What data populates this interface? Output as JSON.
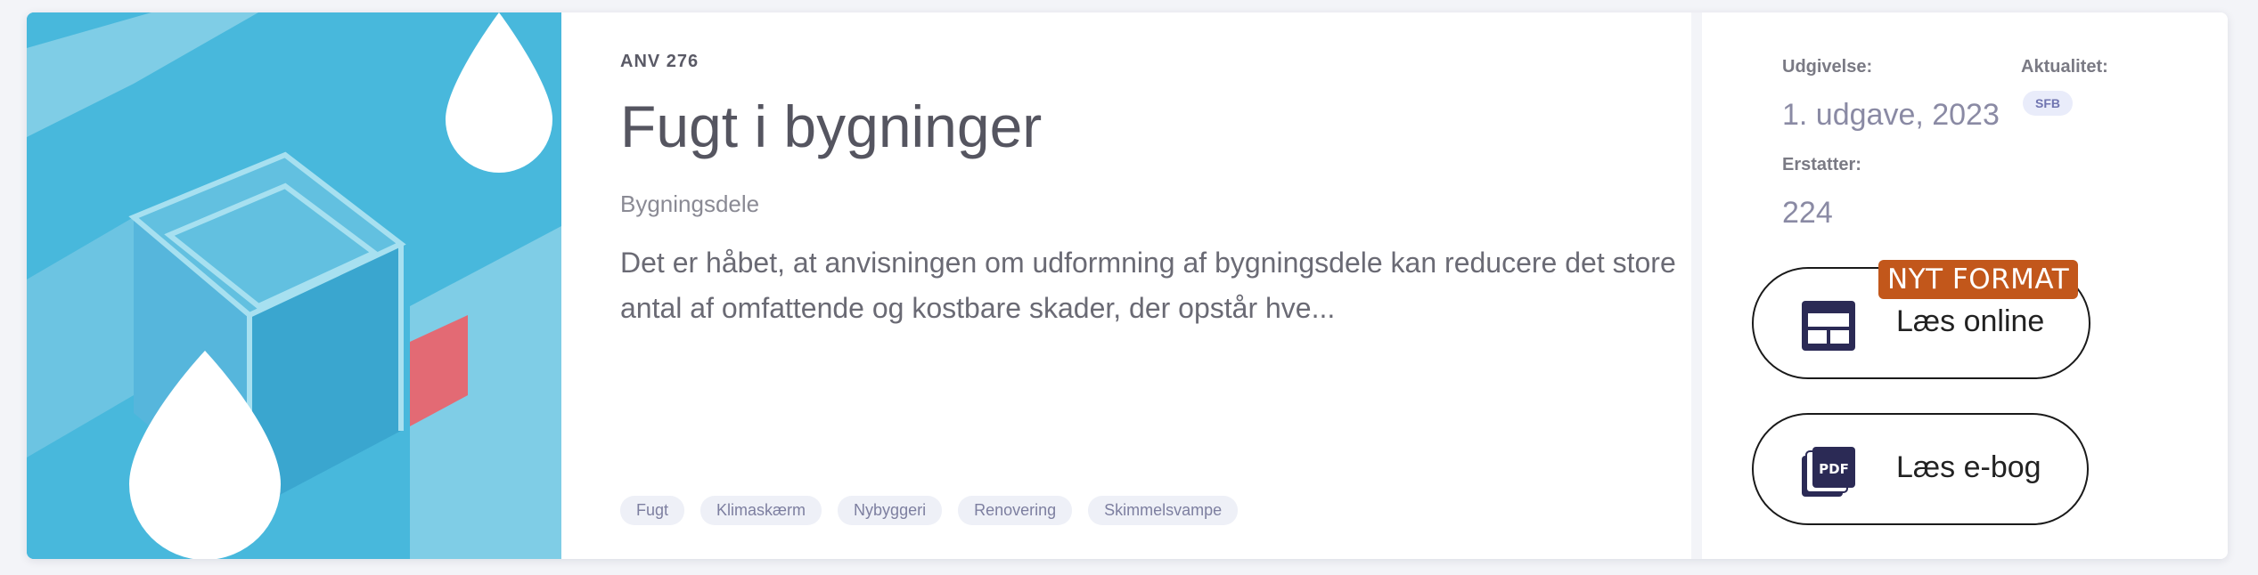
{
  "card": {
    "series": "ANV 276",
    "title": "Fugt i bygninger",
    "category": "Bygningsdele",
    "description": "Det er håbet, at anvisningen om udformning af bygningsdele kan reducere det store antal af omfattende og kostbare skader, der opstår hve...",
    "tags": [
      "Fugt",
      "Klimaskærm",
      "Nybyggeri",
      "Renovering",
      "Skimmelsvampe"
    ]
  },
  "meta": {
    "edition_label": "Udgivelse:",
    "edition_value": "1. udgave, 2023",
    "replaces_label": "Erstatter:",
    "replaces_value": "224",
    "status_label": "Aktualitet:",
    "status_value": "SFB"
  },
  "actions": {
    "read_online_label": "Læs online",
    "read_online_badge": "NYT FORMAT",
    "read_ebook_label": "Læs e-bog",
    "pdf_icon_text": "PDF"
  },
  "colors": {
    "cover_blue": "#48b8dc",
    "badge_orange": "#c2571b",
    "icon_navy": "#2b2a55"
  }
}
